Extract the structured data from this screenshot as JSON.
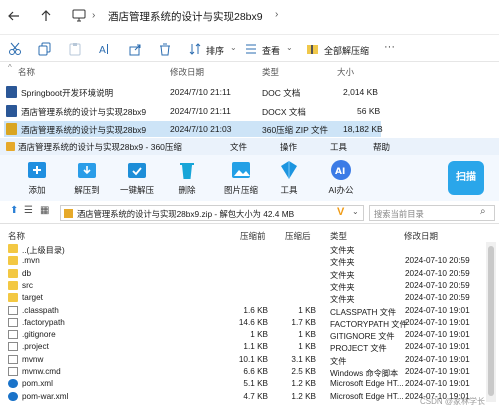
{
  "explorer": {
    "breadcrumb": "酒店管理系统的设计与实现28bx9",
    "toolbar": {
      "sort": "排序",
      "view": "查看",
      "extract_all": "全部解压缩"
    },
    "columns": {
      "name": "名称",
      "modified": "修改日期",
      "type": "类型",
      "size": "大小"
    },
    "files": [
      {
        "name": "Springboot开发环境说明",
        "date": "2024/7/10 21:11",
        "type": "DOC 文档",
        "size": "2,014 KB",
        "icon_color": "#2b5797"
      },
      {
        "name": "酒店管理系统的设计与实现28bx9",
        "date": "2024/7/10 21:11",
        "type": "DOCX 文档",
        "size": "56 KB",
        "icon_color": "#2b5797"
      },
      {
        "name": "酒店管理系统的设计与实现28bx9",
        "date": "2024/7/10 21:03",
        "type": "360压缩 ZIP 文件",
        "size": "18,182 KB",
        "icon_color": "#d9a521"
      }
    ]
  },
  "zip": {
    "title": "酒店管理系统的设计与实现28bx9 - 360压缩",
    "menu": {
      "file": "文件",
      "ops": "操作",
      "tools": "工具",
      "help": "帮助"
    },
    "tools": [
      {
        "label": "添加",
        "color": "#1f8fe0"
      },
      {
        "label": "解压到",
        "color": "#2a9de8"
      },
      {
        "label": "一键解压",
        "color": "#1d8ed8"
      },
      {
        "label": "删除",
        "color": "#17a5d8"
      },
      {
        "label": "图片压缩",
        "color": "#23a0e6"
      },
      {
        "label": "工具",
        "color": "#1c95e0"
      },
      {
        "label": "AI办公",
        "color": "#3b7be6"
      }
    ],
    "scan_label": "扫描",
    "path": "酒店管理系统的设计与实现28bx9.zip - 解包大小为 42.4 MB",
    "search_placeholder": "搜索当前目录",
    "columns": {
      "name": "名称",
      "packed": "压缩前",
      "compressed": "压缩后",
      "type": "类型",
      "modified": "修改日期"
    },
    "rows": [
      {
        "name": "..(上级目录)",
        "packed": "",
        "compressed": "",
        "type": "文件夹",
        "date": "",
        "kind": "folder"
      },
      {
        "name": ".mvn",
        "packed": "",
        "compressed": "",
        "type": "文件夹",
        "date": "2024-07-10 20:59",
        "kind": "folder"
      },
      {
        "name": "db",
        "packed": "",
        "compressed": "",
        "type": "文件夹",
        "date": "2024-07-10 20:59",
        "kind": "folder"
      },
      {
        "name": "src",
        "packed": "",
        "compressed": "",
        "type": "文件夹",
        "date": "2024-07-10 20:59",
        "kind": "folder"
      },
      {
        "name": "target",
        "packed": "",
        "compressed": "",
        "type": "文件夹",
        "date": "2024-07-10 20:59",
        "kind": "folder"
      },
      {
        "name": ".classpath",
        "packed": "1.6 KB",
        "compressed": "1 KB",
        "type": "CLASSPATH 文件",
        "date": "2024-07-10 19:01",
        "kind": "file"
      },
      {
        "name": ".factorypath",
        "packed": "14.6 KB",
        "compressed": "1.7 KB",
        "type": "FACTORYPATH 文件",
        "date": "2024-07-10 19:01",
        "kind": "file"
      },
      {
        "name": ".gitignore",
        "packed": "1 KB",
        "compressed": "1 KB",
        "type": "GITIGNORE 文件",
        "date": "2024-07-10 19:01",
        "kind": "file"
      },
      {
        "name": ".project",
        "packed": "1.1 KB",
        "compressed": "1 KB",
        "type": "PROJECT 文件",
        "date": "2024-07-10 19:01",
        "kind": "file"
      },
      {
        "name": "mvnw",
        "packed": "10.1 KB",
        "compressed": "3.1 KB",
        "type": "文件",
        "date": "2024-07-10 19:01",
        "kind": "file"
      },
      {
        "name": "mvnw.cmd",
        "packed": "6.6 KB",
        "compressed": "2.5 KB",
        "type": "Windows 命令脚本",
        "date": "2024-07-10 19:01",
        "kind": "file"
      },
      {
        "name": "pom.xml",
        "packed": "5.1 KB",
        "compressed": "1.2 KB",
        "type": "Microsoft Edge HT...",
        "date": "2024-07-10 19:01",
        "kind": "edge"
      },
      {
        "name": "pom-war.xml",
        "packed": "4.7 KB",
        "compressed": "1.2 KB",
        "type": "Microsoft Edge HT...",
        "date": "2024-07-10 19:01",
        "kind": "edge"
      }
    ]
  },
  "watermark": "CSDN @家林学长"
}
